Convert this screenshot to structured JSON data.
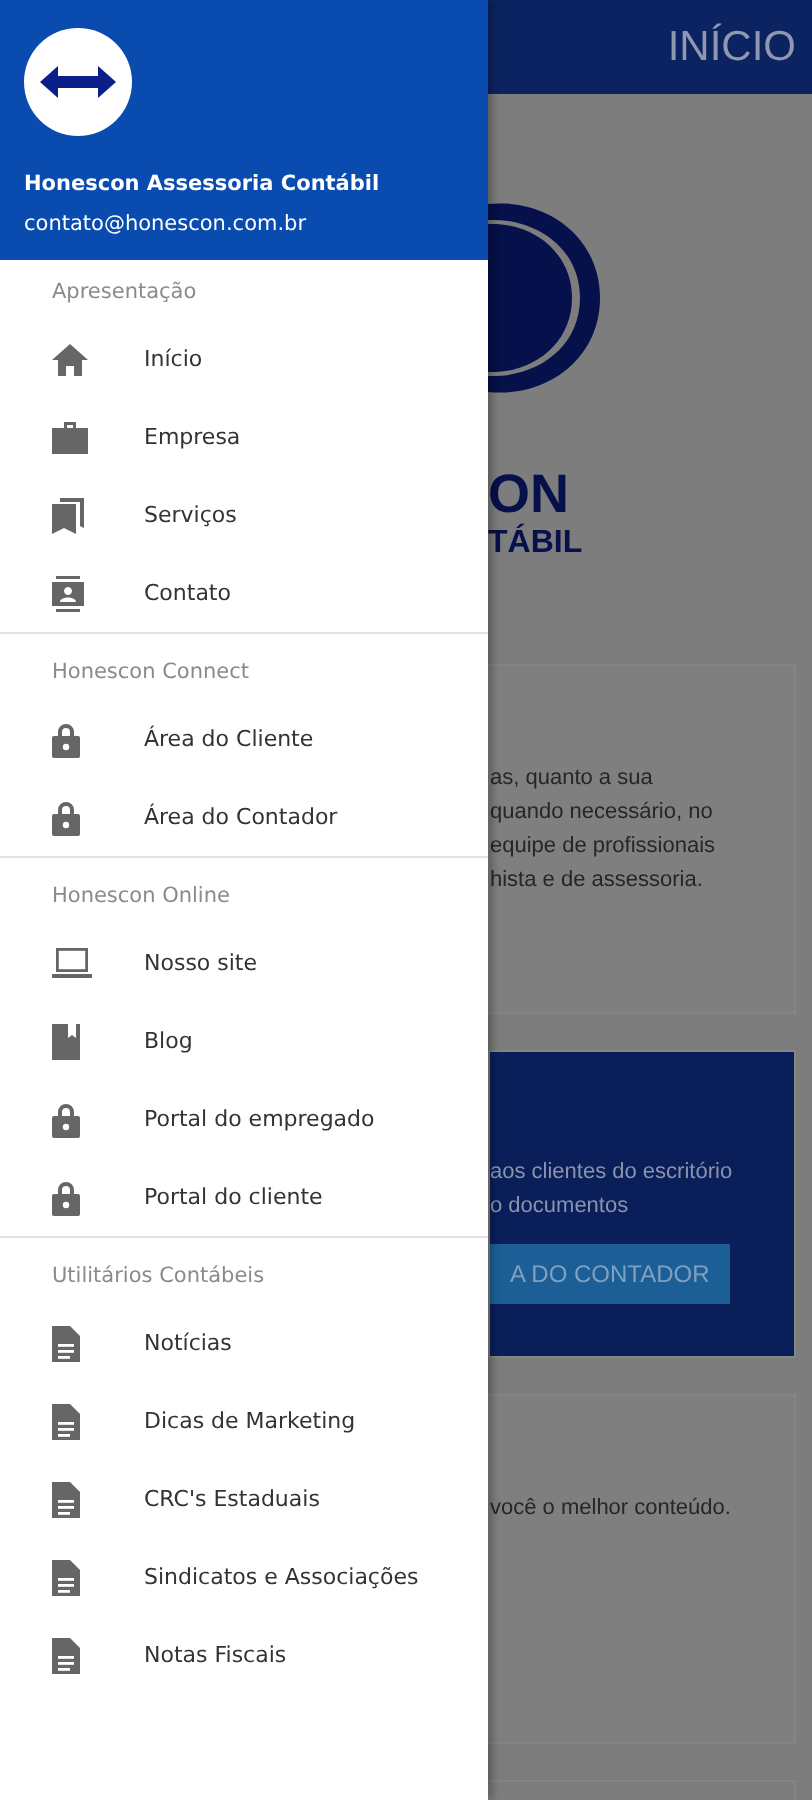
{
  "page": {
    "title": "INÍCIO",
    "logo_lines": [
      "ON",
      "TÁBIL"
    ],
    "cards": [
      {
        "kind": "plain",
        "lines": [
          "as, quanto a sua",
          "quando necessário, no",
          "equipe de profissionais",
          "hista e de assessoria."
        ]
      },
      {
        "kind": "accent",
        "lines": [
          "aos clientes do escritório",
          "o documentos"
        ],
        "button": "A DO CONTADOR"
      },
      {
        "kind": "plain",
        "lines": [
          "você o melhor conteúdo."
        ]
      },
      {
        "kind": "empty"
      }
    ]
  },
  "drawer": {
    "name": "Honescon Assessoria Contábil",
    "email": "contato@honescon.com.br",
    "sections": [
      {
        "title": "Apresentação",
        "items": [
          {
            "label": "Início",
            "kind": "home"
          },
          {
            "label": "Empresa",
            "kind": "briefcase"
          },
          {
            "label": "Serviços",
            "kind": "bookmarks"
          },
          {
            "label": "Contato",
            "kind": "contact"
          }
        ]
      },
      {
        "title": "Honescon Connect",
        "items": [
          {
            "label": "Área do Cliente",
            "kind": "lock"
          },
          {
            "label": "Área do Contador",
            "kind": "lock"
          }
        ]
      },
      {
        "title": "Honescon Online",
        "items": [
          {
            "label": "Nosso site",
            "kind": "laptop"
          },
          {
            "label": "Blog",
            "kind": "book"
          },
          {
            "label": "Portal do empregado",
            "kind": "lock"
          },
          {
            "label": "Portal do cliente",
            "kind": "lock"
          }
        ]
      },
      {
        "title": "Utilitários Contábeis",
        "items": [
          {
            "label": "Notícias",
            "kind": "doc"
          },
          {
            "label": "Dicas de Marketing",
            "kind": "doc"
          },
          {
            "label": "CRC's Estaduais",
            "kind": "doc"
          },
          {
            "label": "Sindicatos e Associações",
            "kind": "doc"
          },
          {
            "label": "Notas Fiscais",
            "kind": "doc"
          }
        ]
      }
    ]
  }
}
